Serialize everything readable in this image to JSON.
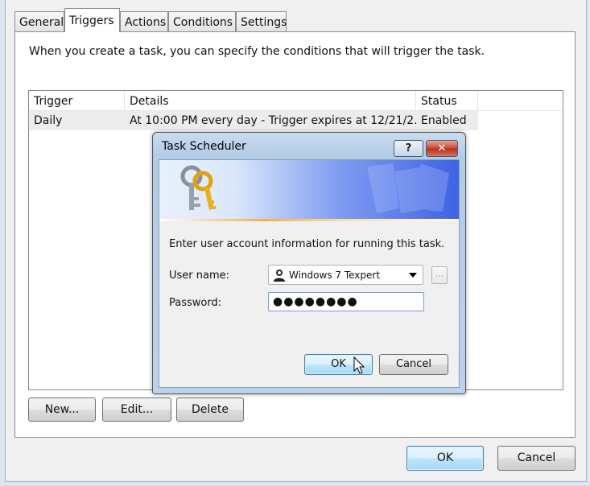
{
  "tabs": [
    {
      "label": "General"
    },
    {
      "label": "Triggers"
    },
    {
      "label": "Actions"
    },
    {
      "label": "Conditions"
    },
    {
      "label": "Settings"
    }
  ],
  "triggers_tab": {
    "intro": "When you create a task, you can specify the conditions that will trigger the task.",
    "columns": [
      "Trigger",
      "Details",
      "Status"
    ],
    "rows": [
      {
        "trigger": "Daily",
        "details": "At 10:00 PM every day - Trigger expires at 12/21/2...",
        "status": "Enabled"
      }
    ],
    "buttons": {
      "new": "New...",
      "edit": "Edit...",
      "delete": "Delete"
    }
  },
  "footer": {
    "ok": "OK",
    "cancel": "Cancel"
  },
  "dialog": {
    "title": "Task Scheduler",
    "help_glyph": "?",
    "close_glyph": "✕",
    "prompt": "Enter user account information for running this task.",
    "username_label": "User name:",
    "username_value": "Windows 7 Texpert",
    "browse_label": "...",
    "password_label": "Password:",
    "password_value": "●●●●●●●●",
    "ok": "OK",
    "cancel": "Cancel"
  },
  "icons": {
    "keys": "keys-icon",
    "user": "user-icon",
    "dropdown": "chevron-down-icon",
    "cursor": "mouse-cursor-icon"
  }
}
